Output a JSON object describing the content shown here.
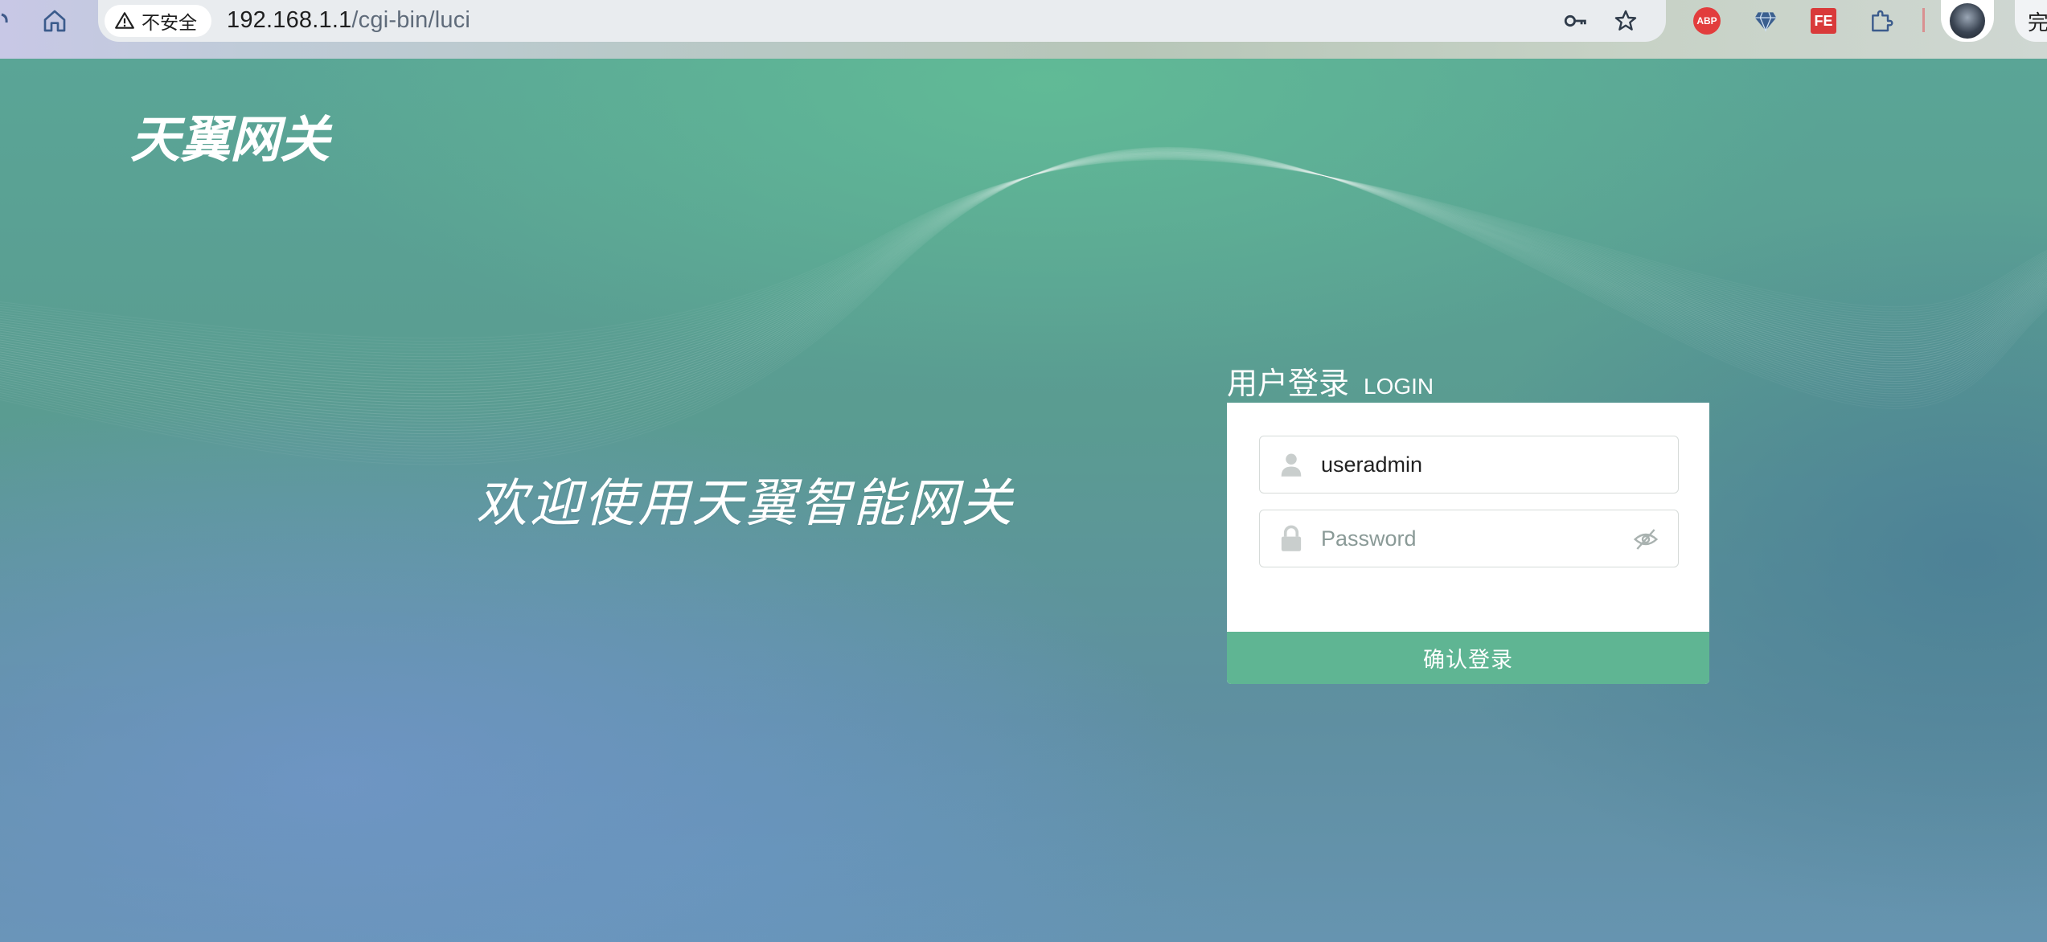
{
  "browser": {
    "security_label": "不安全",
    "url_host": "192.168.1.1",
    "url_path": "/cgi-bin/luci",
    "extensions": [
      "abp-icon",
      "gem-icon",
      "fe-icon",
      "puzzle-icon"
    ],
    "abp_label": "ABP",
    "fe_label": "FE",
    "done_label": "完成"
  },
  "page": {
    "logo_text": "天翼网关",
    "welcome_text": "欢迎使用天翼智能网关",
    "login": {
      "title_cn": "用户登录",
      "title_en": "LOGIN",
      "username_value": "useradmin",
      "password_placeholder": "Password",
      "submit_label": "确认登录"
    }
  },
  "colors": {
    "accent": "#5fb593",
    "card": "#ffffff"
  }
}
